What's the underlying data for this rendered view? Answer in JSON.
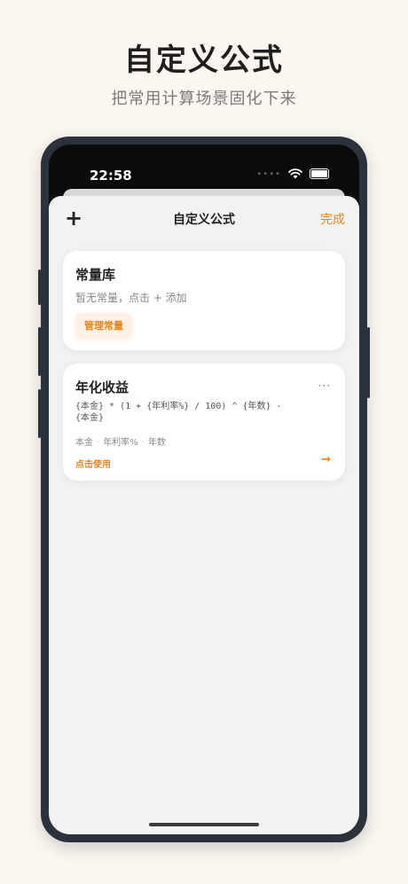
{
  "promo": {
    "title": "自定义公式",
    "subtitle": "把常用计算场景固化下来"
  },
  "status_bar": {
    "time": "22:58"
  },
  "nav": {
    "add": "+",
    "title": "自定义公式",
    "done": "完成"
  },
  "constants_card": {
    "title": "常量库",
    "empty_text": "暂无常量，点击 + 添加",
    "manage_button": "管理常量"
  },
  "formula_card": {
    "title": "年化收益",
    "more": "···",
    "formula_line1": "{本金} * (1 + {年利率%} / 100) ^ {年数} -",
    "formula_line2": "{本金}",
    "variables": [
      "本金",
      "年利率%",
      "年数"
    ],
    "separator": "·",
    "use_link": "点击使用",
    "arrow": "→"
  },
  "colors": {
    "accent": "#e8871e",
    "background": "#fcf6f1",
    "phone_frame": "#2b323c"
  }
}
